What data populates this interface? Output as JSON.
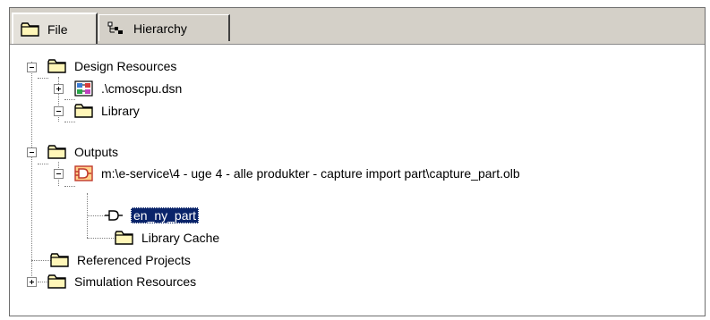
{
  "tabs": [
    {
      "label": "File",
      "icon": "folder-icon",
      "active": true
    },
    {
      "label": "Hierarchy",
      "icon": "hierarchy-icon",
      "active": false
    }
  ],
  "tree": {
    "design_resources": "Design Resources",
    "dsn_file": ".\\cmoscpu.dsn",
    "library": "Library",
    "outputs": "Outputs",
    "olb_path": "m:\\e-service\\4 - uge 4 - alle produkter - capture import part\\capture_part.olb",
    "part": "en_ny_part",
    "library_cache": "Library Cache",
    "referenced_projects": "Referenced Projects",
    "simulation_resources": "Simulation Resources"
  },
  "colors": {
    "folder": "#fff6b8",
    "folder_outline": "#000000",
    "selection": "#0a246a",
    "chrome": "#d4d0c8"
  }
}
